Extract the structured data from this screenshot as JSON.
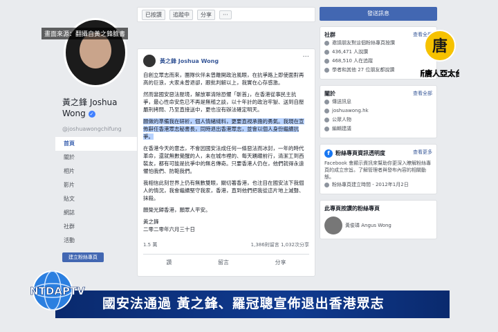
{
  "overlay": {
    "news_label": "畫面來源：翻攝自黃之鋒臉書",
    "caption": "國安法通過  黃之鋒、羅冠聰宣佈退出香港眾志",
    "station_logo_text": "新唐人亞太台",
    "station_logo_char": "唐",
    "ap_logo_text": "NTDAPTV"
  },
  "profile": {
    "name": "黃之鋒 Joshua Wong",
    "handle": "@joshuawongchifung",
    "verified_mark": "✓",
    "nav": [
      "首頁",
      "關於",
      "相片",
      "影片",
      "貼文",
      "網誌",
      "社群",
      "活動"
    ],
    "create_page_label": "建立粉絲專頁"
  },
  "toolbar": {
    "liked_label": "已按讚",
    "following_label": "追蹤中",
    "share_label": "分享",
    "more_label": "···"
  },
  "post": {
    "author": "黃之鋒 Joshua Wong",
    "more": "···",
    "paragraphs": [
      "自創立眾志而來，團隊伙伴未曾離開政治風眼，在抗爭路上即使面對再高的巨浪，大家未曾退卻，跟批判解以上，我實在心存感激。",
      "然而當國安惡法壓境，解放軍清除恐懼「斬首」，在香港從事民主抗爭，最心性命安危已不再是無稽之談，以十年計的政治牢獄、送到自壓嚴刑拷問、乃至直接送中，更也沒有辦法確定明天。",
      "在香港今天的意志，不會因國安法成任何一條惡法而冰封，一年的時代革命，還就無數覺醒的人，未在城市裡的、每天踴躍前行，清潔工到西裝友，都有可能是抗爭中的無名傳奇。只要香港人仍在，他們就得永遠懼怕我們、防範我們。",
      "我相信此刻世界上仍有無數雙眼，關切著香港，也注目在國安法下我個人的情況，我會繼續堅守我家，香港，直到他們把我從這片地上滅聲、抹殺。",
      "願榮光歸香港，願眾人平安。",
      "黃之鋒",
      "二零二零年六月三十日"
    ],
    "highlighted": "願做的準備我在研析，個人情緒縫料，更要直視承擔的勇氣。我現在宣佈辭任香港眾志秘書長，同時退出香港眾志，並會以個人身份繼續抗爭。",
    "reaction_count": "1.5 萬",
    "comments": "1,386則留言",
    "shares": "1,032次分享",
    "action_like": "讚",
    "action_comment": "留言",
    "action_share": "分享"
  },
  "sidebar": {
    "send_message": "發送訊息",
    "community": {
      "title": "社群",
      "more": "查看全部",
      "lines": [
        "邀請朋友對這個粉絲專頁按讚",
        "436,471 人說讚",
        "468,510 人在追蹤",
        "學者和其他 27 位朋友都說讚"
      ]
    },
    "about": {
      "title": "關於",
      "more": "查看全部",
      "lines": [
        "傳送訊息",
        "joshuawong.hk",
        "公眾人物",
        "編輯建議"
      ]
    },
    "transparency": {
      "title": "粉絲專頁資訊透明度",
      "more": "查看更多",
      "body": "Facebook 會顯示資訊來幫助你更深入瞭解粉絲專頁的成立宗旨。了解管理者與發布內容的相關動態。",
      "created": "粉絲專頁建立時間 - 2012年1月2日"
    },
    "liked_pages": {
      "title": "此專頁按讚的粉絲專頁",
      "person": "黃俊璘 Angus Wong"
    }
  }
}
